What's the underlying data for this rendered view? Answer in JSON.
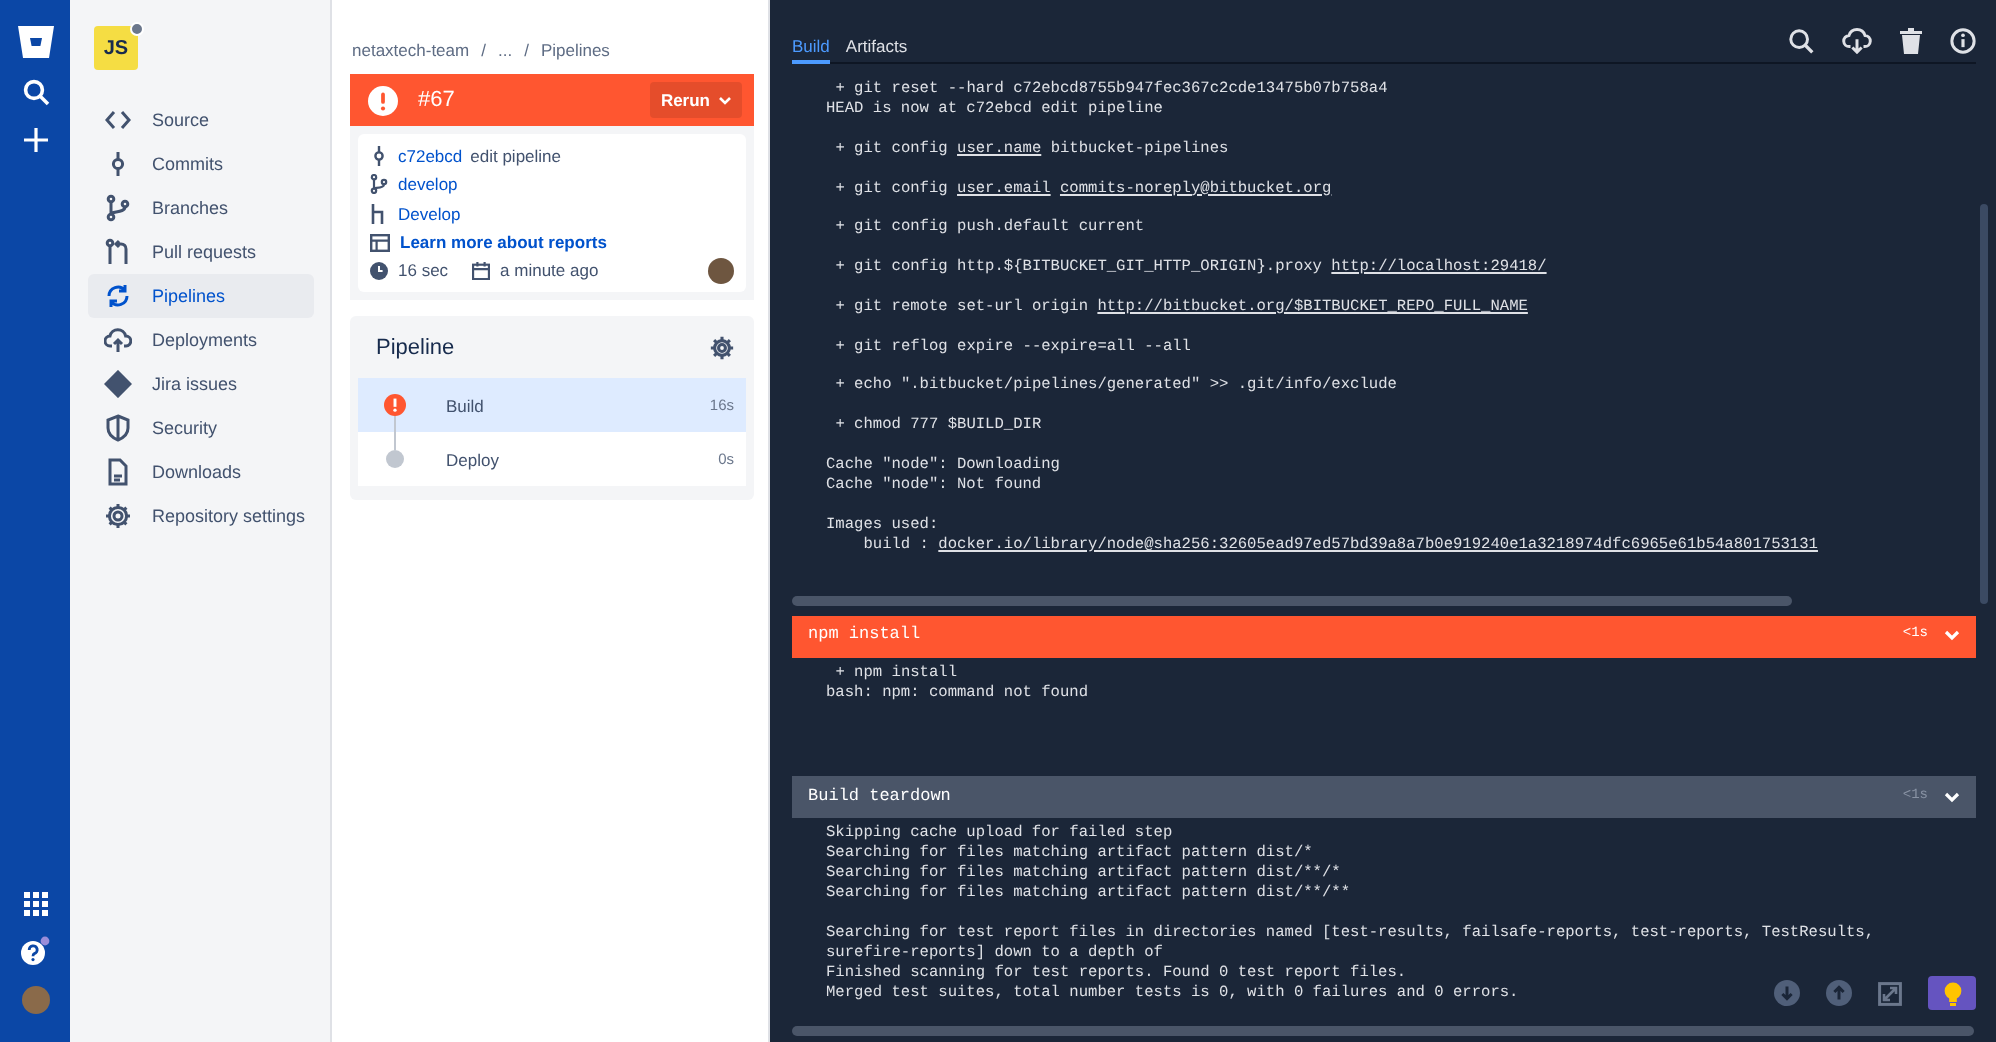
{
  "repo": {
    "avatar_text": "JS"
  },
  "sidebar": {
    "items": [
      {
        "label": "Source",
        "selected": false
      },
      {
        "label": "Commits",
        "selected": false
      },
      {
        "label": "Branches",
        "selected": false
      },
      {
        "label": "Pull requests",
        "selected": false
      },
      {
        "label": "Pipelines",
        "selected": true
      },
      {
        "label": "Deployments",
        "selected": false
      },
      {
        "label": "Jira issues",
        "selected": false
      },
      {
        "label": "Security",
        "selected": false
      },
      {
        "label": "Downloads",
        "selected": false
      },
      {
        "label": "Repository settings",
        "selected": false
      }
    ]
  },
  "breadcrumbs": [
    "netaxtech-team",
    "/",
    "...",
    "/",
    "Pipelines"
  ],
  "pipeline_run": {
    "failed": true,
    "number": "#67",
    "rerun_label": "Rerun",
    "commit_hash": "c72ebcd",
    "commit_message": "edit pipeline",
    "branch": "develop",
    "deployment": "Develop",
    "reports_link": "Learn more about reports",
    "duration": "16 sec",
    "time": "a minute ago"
  },
  "pipeline": {
    "title": "Pipeline",
    "steps": [
      {
        "name": "Build",
        "duration": "16s",
        "failed": true,
        "selected": true
      },
      {
        "name": "Deploy",
        "duration": "0s",
        "failed": false,
        "selected": false
      }
    ]
  },
  "log": {
    "tabs": [
      {
        "label": "Build",
        "selected": true
      },
      {
        "label": "Artifacts",
        "selected": false
      }
    ],
    "sections": [
      {
        "blocks": [
          [
            [
              " + git reset --hard c72ebcd8755b947fec367c2cde13475b07b758a4"
            ],
            [
              "HEAD is now at c72ebcd edit pipeline"
            ]
          ],
          [
            [
              " + git config ",
              {
                "link": "user.name"
              },
              " bitbucket-pipelines"
            ]
          ],
          [
            [
              " + git config ",
              {
                "link": "user.email"
              },
              {
                "link": "commits-noreply@bitbucket.org"
              }
            ]
          ],
          [
            [
              " + git config push.default current"
            ]
          ],
          [
            [
              " + git config http.${BITBUCKET_GIT_HTTP_ORIGIN}.proxy ",
              {
                "link": "http://localhost:29418/"
              }
            ]
          ],
          [
            [
              " + git remote set-url origin ",
              {
                "link": "http://bitbucket.org/$BITBUCKET_REPO_FULL_NAME"
              }
            ]
          ],
          [
            [
              " + git reflog expire --expire=all --all"
            ]
          ],
          [
            [
              " + echo \".bitbucket/pipelines/generated\" >> .git/info/exclude"
            ]
          ],
          [
            [
              " + chmod 777 $BUILD_DIR"
            ]
          ],
          [
            [
              "Cache \"node\": Downloading"
            ],
            [
              "Cache \"node\": Not found"
            ]
          ],
          [
            [
              "Images used:"
            ],
            [
              "    build : ",
              {
                "link": "docker.io/library/node@sha256:32605ead97ed57bd39a8a7b0e919240e1a3218974dfc6965e61b54a801753131"
              }
            ]
          ]
        ]
      },
      {
        "header": {
          "title": "npm install",
          "failed": true,
          "duration": "<1s"
        },
        "blocks": [
          [
            [
              " + npm install"
            ],
            [
              "bash: npm: command not found"
            ]
          ]
        ]
      },
      {
        "header": {
          "title": "Build teardown",
          "failed": false,
          "duration": "<1s"
        },
        "blocks": [
          [
            [
              "Skipping cache upload for failed step"
            ],
            [
              "Searching for files matching artifact pattern dist/*"
            ],
            [
              "Searching for files matching artifact pattern dist/**/*"
            ],
            [
              "Searching for files matching artifact pattern dist/**/**"
            ]
          ],
          [
            [
              "Searching for test report files in directories named [test-results, failsafe-reports, test-reports, TestResults, surefire-reports] down to a depth of"
            ],
            [
              "Finished scanning for test reports. Found 0 test report files."
            ],
            [
              "Merged test suites, total number tests is 0, with 0 failures and 0 errors."
            ]
          ]
        ]
      }
    ]
  }
}
